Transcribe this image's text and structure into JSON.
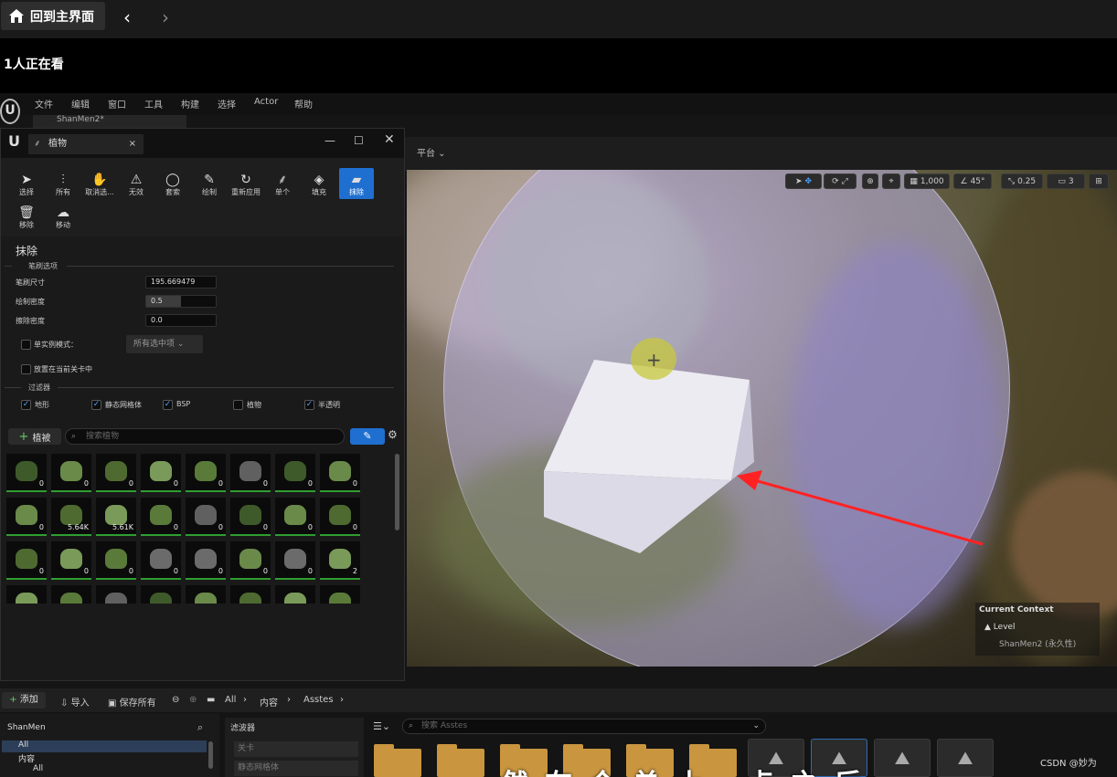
{
  "player": {
    "home_label": "回到主界面",
    "viewers": "1人正在看"
  },
  "menu": [
    "文件",
    "编辑",
    "窗口",
    "工具",
    "构建",
    "选择",
    "Actor",
    "帮助"
  ],
  "level_tab": "ShanMen2*",
  "viewport": {
    "platform_label": "平台",
    "grid_size": "1,000",
    "rotation_snap": "45°",
    "scale_snap": "0.25",
    "camera_speed": "3",
    "context_title": "Current Context",
    "context_level_label": "Level",
    "context_level_value": "ShanMen2 (永久性)"
  },
  "foliage": {
    "panel_title": "植物",
    "tools": [
      "选择",
      "所有",
      "取消选...",
      "无效",
      "套索",
      "绘制",
      "重新应用",
      "单个",
      "填充",
      "抹除",
      "移除",
      "移动"
    ],
    "active_tool": "抹除",
    "section_title": "抹除",
    "brush_group": "笔刷选项",
    "brush_size_label": "笔刷尺寸",
    "brush_size": "195.669479",
    "paint_density_label": "绘制密度",
    "paint_density": "0.5",
    "paint_density_fraction": 0.5,
    "erase_density_label": "擦除密度",
    "erase_density": "0.0",
    "single_instance_label": "单实例模式：",
    "single_instance_dropdown": "所有选中项",
    "place_current_level_label": "放置在当前关卡中",
    "filter_group": "过滤器",
    "filters": [
      {
        "label": "地形",
        "checked": true
      },
      {
        "label": "静态网格体",
        "checked": true
      },
      {
        "label": "BSP",
        "checked": true
      },
      {
        "label": "植物",
        "checked": false
      },
      {
        "label": "半透明",
        "checked": true
      }
    ],
    "add_foliage_label": "植被",
    "search_placeholder": "搜索植物",
    "counts": [
      [
        "0",
        "0",
        "0",
        "0",
        "0",
        "0",
        "0",
        "0"
      ],
      [
        "0",
        "5.64K",
        "5.61K",
        "0",
        "0",
        "0",
        "0",
        "0"
      ],
      [
        "0",
        "0",
        "0",
        "0",
        "0",
        "0",
        "0",
        "2"
      ],
      [
        "",
        "",
        "",
        "",
        "",
        "",
        "",
        ""
      ]
    ]
  },
  "content_browser": {
    "add_label": "添加",
    "import_label": "导入",
    "save_all_label": "保存所有",
    "breadcrumb": [
      "All",
      "内容",
      "Asstes"
    ],
    "tree_title": "ShanMen",
    "tree_items": [
      "All",
      "内容",
      "All"
    ],
    "filters_title": "滤波器",
    "filter_items": [
      "关卡",
      "静态网格体"
    ],
    "asset_search_placeholder": "搜索 Asstes"
  },
  "watermark": "CSDN @妙为",
  "subtitle": "然在个单上 点之后"
}
